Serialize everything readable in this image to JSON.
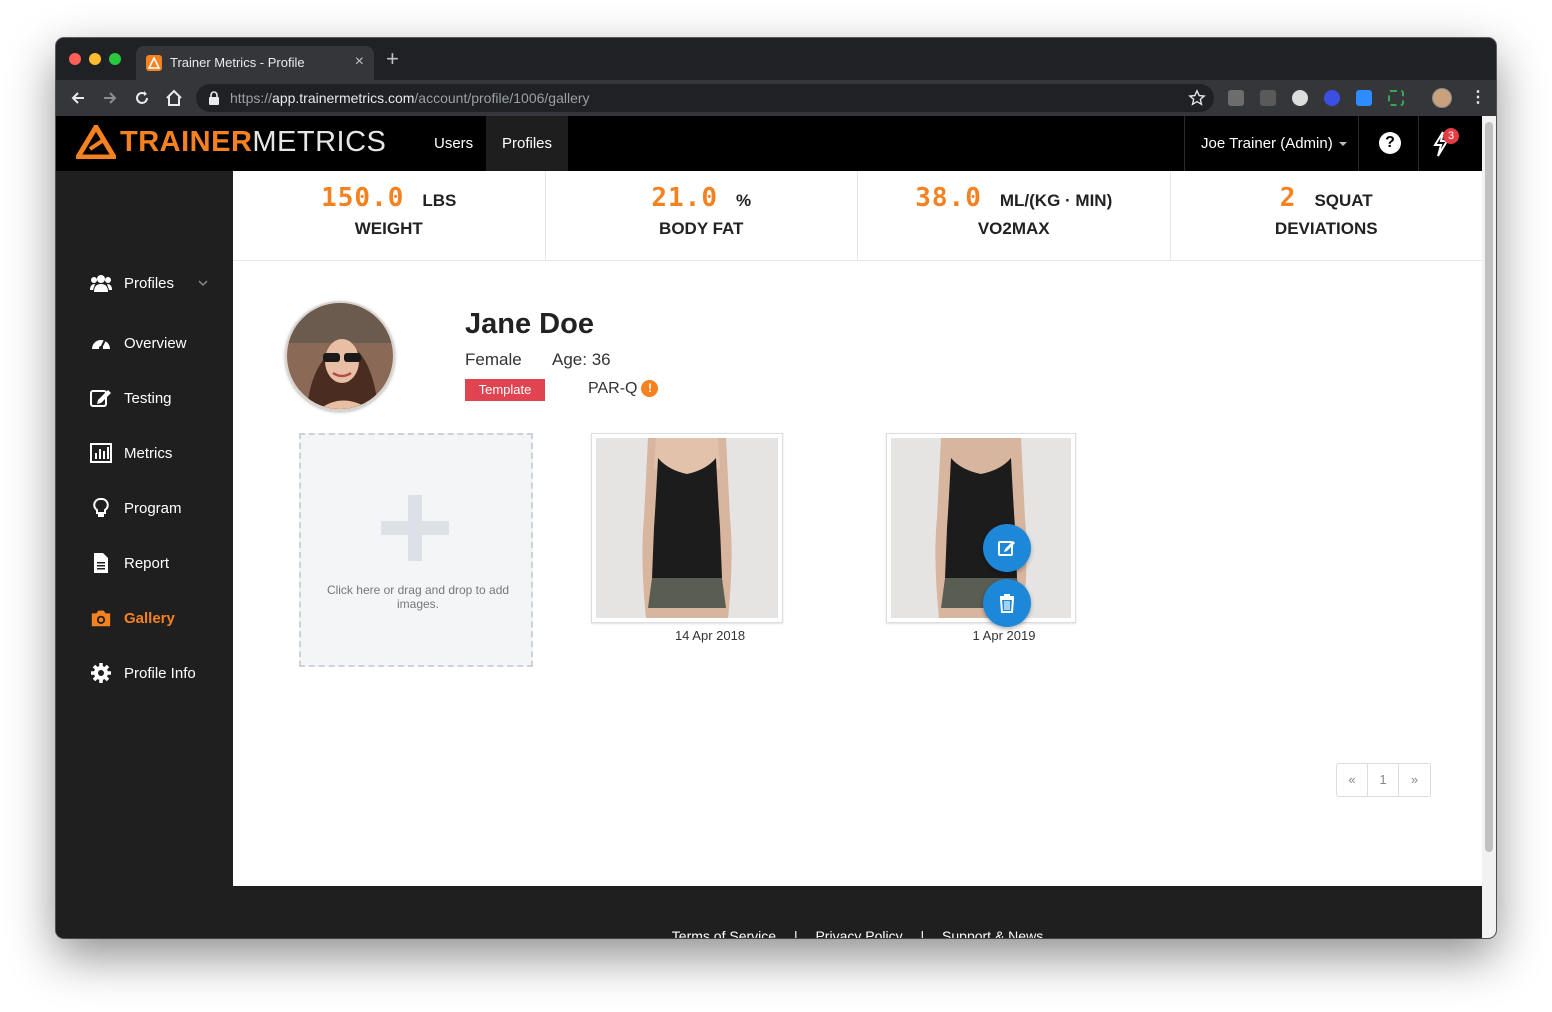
{
  "browser": {
    "tab_title": "Trainer Metrics - Profile",
    "url_prefix": "https://",
    "url_host": "app.trainermetrics.com",
    "url_path": "/account/profile/1006/gallery",
    "new_tab_label": "+",
    "close_tab_label": "×"
  },
  "header": {
    "logo_part1": "TRAINER",
    "logo_part2": "METRICS",
    "nav": [
      {
        "label": "Users"
      },
      {
        "label": "Profiles"
      }
    ],
    "user_menu": "Joe Trainer (Admin)",
    "help_label": "?",
    "notification_count": "3"
  },
  "sidebar": {
    "items": [
      {
        "label": "Profiles",
        "icon": "users-icon"
      },
      {
        "label": "Overview",
        "icon": "dashboard-icon"
      },
      {
        "label": "Testing",
        "icon": "edit-icon"
      },
      {
        "label": "Metrics",
        "icon": "bar-chart-icon"
      },
      {
        "label": "Program",
        "icon": "lightbulb-icon"
      },
      {
        "label": "Report",
        "icon": "document-icon"
      },
      {
        "label": "Gallery",
        "icon": "camera-icon",
        "active": true
      },
      {
        "label": "Profile Info",
        "icon": "gear-icon"
      }
    ]
  },
  "stats": [
    {
      "value": "150.0",
      "unit": "LBS",
      "label": "WEIGHT"
    },
    {
      "value": "21.0",
      "unit": "%",
      "label": "BODY FAT"
    },
    {
      "value": "38.0",
      "unit": "ML/(KG · MIN)",
      "label": "VO2MAX"
    },
    {
      "value": "2",
      "unit": "SQUAT",
      "label": "DEVIATIONS"
    }
  ],
  "profile": {
    "name": "Jane Doe",
    "gender": "Female",
    "age": "Age: 36",
    "template_badge": "Template",
    "parq_label": "PAR-Q",
    "parq_warning": "!"
  },
  "gallery": {
    "dropzone_text": "Click here or drag and drop to add images.",
    "photos": [
      {
        "date": "14 Apr 2018"
      },
      {
        "date": "1 Apr 2019"
      }
    ]
  },
  "pagination": {
    "prev": "«",
    "page": "1",
    "next": "»"
  },
  "footer": {
    "links": [
      "Terms of Service",
      "Privacy Policy",
      "Support & News"
    ],
    "separator": "|"
  },
  "colors": {
    "accent": "#f58220",
    "active_fab": "#1e88d8",
    "badge_red": "#df4450"
  }
}
